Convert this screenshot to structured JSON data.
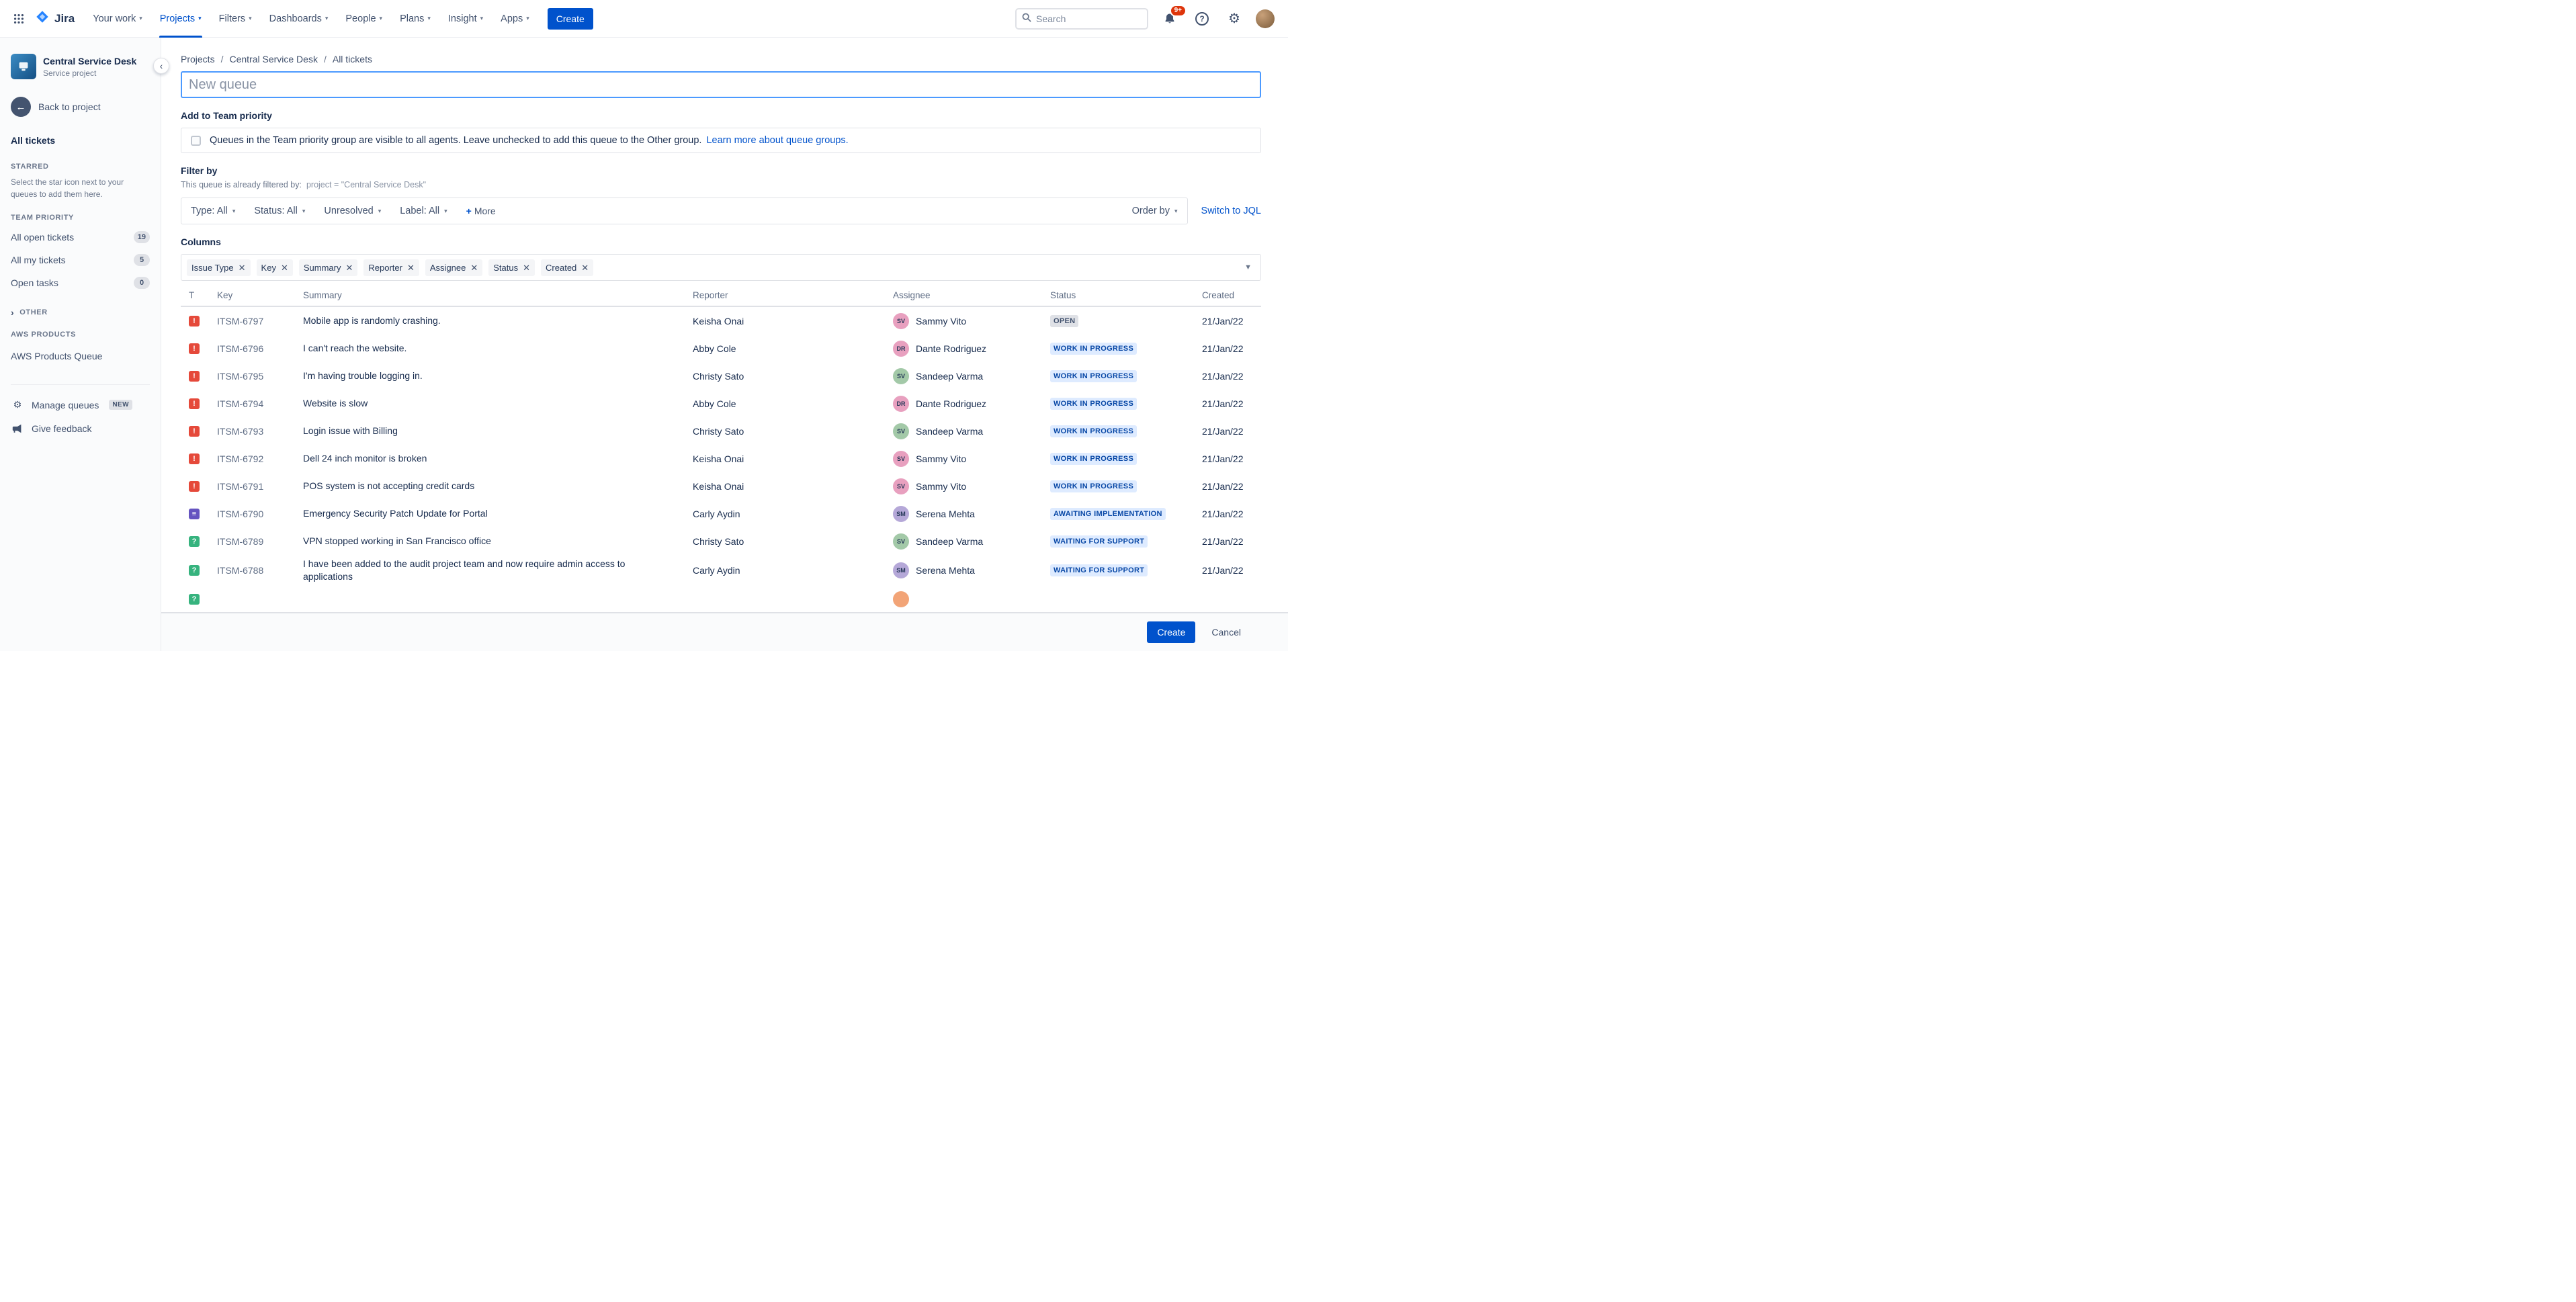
{
  "nav": {
    "logo": "Jira",
    "items": [
      {
        "label": "Your work"
      },
      {
        "label": "Projects",
        "active": true
      },
      {
        "label": "Filters"
      },
      {
        "label": "Dashboards"
      },
      {
        "label": "People"
      },
      {
        "label": "Plans"
      },
      {
        "label": "Insight"
      },
      {
        "label": "Apps"
      }
    ],
    "create_label": "Create",
    "search_placeholder": "Search",
    "notifications_badge": "9+"
  },
  "sidebar": {
    "project_name": "Central Service Desk",
    "project_type": "Service project",
    "back_label": "Back to project",
    "all_tickets_label": "All tickets",
    "starred_heading": "STARRED",
    "starred_hint": "Select the star icon next to your queues to add them here.",
    "team_priority_heading": "TEAM PRIORITY",
    "queues": [
      {
        "label": "All open tickets",
        "count": "19"
      },
      {
        "label": "All my tickets",
        "count": "5"
      },
      {
        "label": "Open tasks",
        "count": "0"
      }
    ],
    "other_heading": "OTHER",
    "aws_heading": "AWS PRODUCTS",
    "aws_queue_label": "AWS Products Queue",
    "manage_queues_label": "Manage queues",
    "manage_queues_badge": "NEW",
    "give_feedback_label": "Give feedback"
  },
  "breadcrumb": {
    "separator": "/",
    "items": [
      "Projects",
      "Central Service Desk",
      "All tickets"
    ]
  },
  "queue_form": {
    "name_placeholder": "New queue",
    "team_priority_heading": "Add to Team priority",
    "checkbox_text": "Queues in the Team priority group are visible to all agents. Leave unchecked to add this queue to the Other group.",
    "checkbox_link": "Learn more about queue groups.",
    "filter_heading": "Filter by",
    "filter_note": "This queue is already filtered by:",
    "filter_expression": "project = \"Central Service Desk\"",
    "filters": [
      {
        "label": "Type: All"
      },
      {
        "label": "Status: All"
      },
      {
        "label": "Unresolved"
      },
      {
        "label": "Label: All"
      }
    ],
    "more": {
      "icon": "+",
      "label": "More"
    },
    "order_by_label": "Order by",
    "switch_jql_label": "Switch to JQL",
    "columns_heading": "Columns",
    "column_tags": [
      "Issue Type",
      "Key",
      "Summary",
      "Reporter",
      "Assignee",
      "Status",
      "Created"
    ]
  },
  "table": {
    "headers": [
      "T",
      "Key",
      "Summary",
      "Reporter",
      "Assignee",
      "Status",
      "Created"
    ],
    "rows": [
      {
        "type": "incident",
        "key": "ITSM-6797",
        "summary": "Mobile app is randomly crashing.",
        "reporter": "Keisha Onai",
        "assignee": "Sammy Vito",
        "status": "OPEN",
        "status_color": "grey",
        "created": "21/Jan/22"
      },
      {
        "type": "incident",
        "key": "ITSM-6796",
        "summary": "I can't reach the website.",
        "reporter": "Abby Cole",
        "assignee": "Dante Rodriguez",
        "status": "WORK IN PROGRESS",
        "status_color": "blue",
        "created": "21/Jan/22"
      },
      {
        "type": "incident",
        "key": "ITSM-6795",
        "summary": "I'm having trouble logging in.",
        "reporter": "Christy Sato",
        "assignee": "Sandeep Varma",
        "status": "WORK IN PROGRESS",
        "status_color": "blue",
        "created": "21/Jan/22"
      },
      {
        "type": "incident",
        "key": "ITSM-6794",
        "summary": "Website is slow",
        "reporter": "Abby Cole",
        "assignee": "Dante Rodriguez",
        "status": "WORK IN PROGRESS",
        "status_color": "blue",
        "created": "21/Jan/22"
      },
      {
        "type": "incident",
        "key": "ITSM-6793",
        "summary": "Login issue with Billing",
        "reporter": "Christy Sato",
        "assignee": "Sandeep Varma",
        "status": "WORK IN PROGRESS",
        "status_color": "blue",
        "created": "21/Jan/22"
      },
      {
        "type": "incident",
        "key": "ITSM-6792",
        "summary": "Dell 24 inch monitor is broken",
        "reporter": "Keisha Onai",
        "assignee": "Sammy Vito",
        "status": "WORK IN PROGRESS",
        "status_color": "blue",
        "created": "21/Jan/22"
      },
      {
        "type": "incident",
        "key": "ITSM-6791",
        "summary": "POS system is not accepting credit cards",
        "reporter": "Keisha Onai",
        "assignee": "Sammy Vito",
        "status": "WORK IN PROGRESS",
        "status_color": "blue",
        "created": "21/Jan/22"
      },
      {
        "type": "change",
        "key": "ITSM-6790",
        "summary": "Emergency Security Patch Update for Portal",
        "reporter": "Carly Aydin",
        "assignee": "Serena Mehta",
        "status": "AWAITING IMPLEMENTATION",
        "status_color": "blue",
        "created": "21/Jan/22"
      },
      {
        "type": "service-request",
        "key": "ITSM-6789",
        "summary": "VPN stopped working in San Francisco office",
        "reporter": "Christy Sato",
        "assignee": "Sandeep Varma",
        "status": "WAITING FOR SUPPORT",
        "status_color": "blue",
        "created": "21/Jan/22"
      },
      {
        "type": "service-request",
        "key": "ITSM-6788",
        "summary": "I have been added to the audit project team and now require admin access to applications",
        "reporter": "Carly Aydin",
        "assignee": "Serena Mehta",
        "status": "WAITING FOR SUPPORT",
        "status_color": "blue",
        "created": "21/Jan/22"
      },
      {
        "type": "service-request",
        "partial": true
      }
    ]
  },
  "footer": {
    "create_label": "Create",
    "cancel_label": "Cancel"
  },
  "colors": {
    "brand": "#0052CC",
    "focus_border": "#4C9AFF",
    "incident_icon": "#E5493A",
    "change_icon": "#6554C0",
    "service_request_icon": "#36B37E",
    "status_grey_bg": "#DFE1E6",
    "status_blue_bg": "#DEEBFF",
    "status_blue_text": "#0747A6",
    "notification_badge": "#DE350B"
  }
}
